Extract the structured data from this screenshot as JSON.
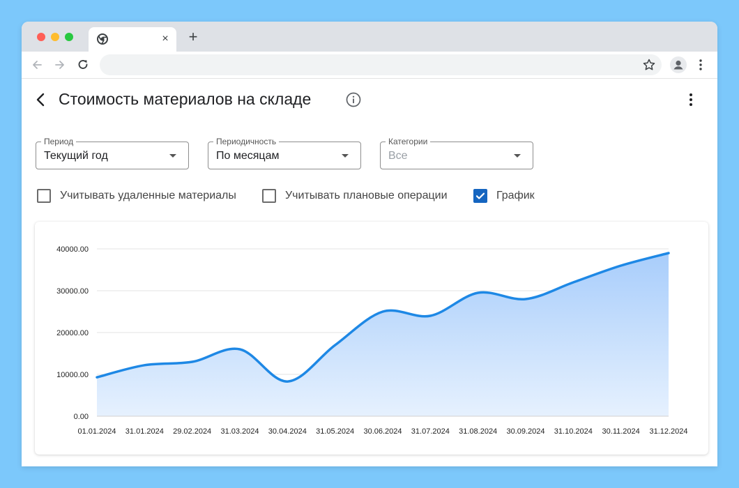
{
  "browser": {
    "tab_close": "×",
    "new_tab": "+"
  },
  "page": {
    "title": "Стоимость материалов на складе"
  },
  "filters": {
    "period": {
      "label": "Период",
      "value": "Текущий год"
    },
    "frequency": {
      "label": "Периодичность",
      "value": "По месяцам"
    },
    "categories": {
      "label": "Категории",
      "placeholder": "Все"
    }
  },
  "options": [
    {
      "label": "Учитывать удаленные материалы",
      "checked": false
    },
    {
      "label": "Учитывать плановые операции",
      "checked": false
    },
    {
      "label": "График",
      "checked": true
    }
  ],
  "colors": {
    "line": "#1e88e5",
    "fill_top": "#a8cdfb",
    "fill_bottom": "#e6f1fe",
    "accent": "#1565c0"
  },
  "chart_data": {
    "type": "area",
    "x": [
      "01.01.2024",
      "31.01.2024",
      "29.02.2024",
      "31.03.2024",
      "30.04.2024",
      "31.05.2024",
      "30.06.2024",
      "31.07.2024",
      "31.08.2024",
      "30.09.2024",
      "31.10.2024",
      "30.11.2024",
      "31.12.2024"
    ],
    "series": [
      {
        "values": [
          9300,
          12200,
          13000,
          16000,
          8300,
          17000,
          25000,
          24000,
          29500,
          28000,
          32000,
          36000,
          39000
        ]
      }
    ],
    "ylim": [
      0,
      40000
    ],
    "yticks": [
      "0.00",
      "10000.00",
      "20000.00",
      "30000.00",
      "40000.00"
    ],
    "grid": true,
    "legend": "none"
  }
}
